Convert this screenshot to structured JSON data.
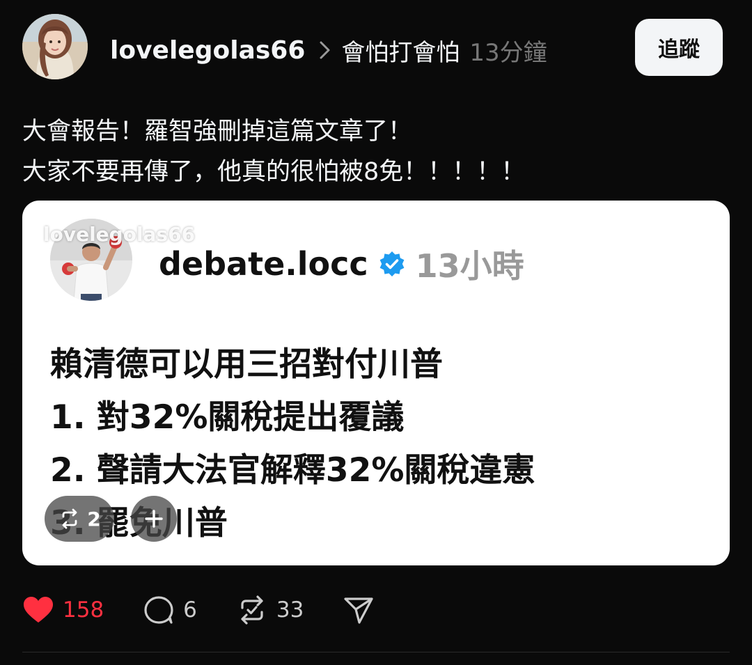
{
  "post": {
    "username": "lovelegolas66",
    "topic": "會怕打會怕",
    "time": "13分鐘",
    "follow_label": "追蹤",
    "text_lines": [
      "大會報告！羅智強刪掉這篇文章了！",
      "大家不要再傳了，他真的很怕被8免！！！！！"
    ]
  },
  "embed": {
    "watermark": "lovelegolas66",
    "username": "debate.locc",
    "time": "13小時",
    "body_lines": [
      "賴清德可以用三招對付川普",
      "1. 對32%關稅提出覆議",
      "2. 聲請大法官解釋32%關稅違憲",
      "3. 罷免川普"
    ],
    "repost_count": "2"
  },
  "actions": {
    "likes": "158",
    "comments": "6",
    "reposts": "33"
  },
  "colors": {
    "background": "#0a0a0a",
    "like": "#ff3040",
    "verified": "#1d9bf0"
  },
  "icons": [
    "chevron-right-icon",
    "verified-badge-icon",
    "repost-icon",
    "plus-icon",
    "heart-icon",
    "comment-icon",
    "share-icon"
  ]
}
